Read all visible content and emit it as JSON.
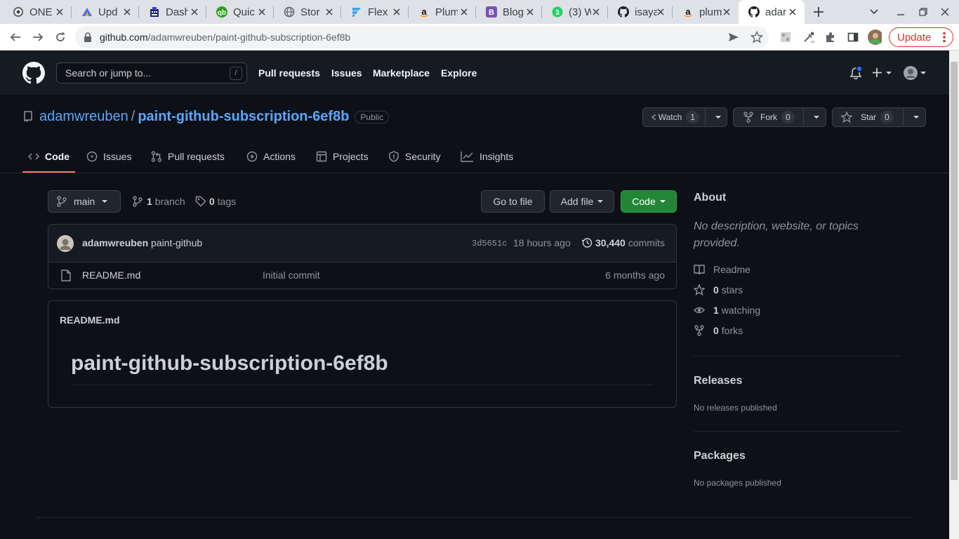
{
  "browser": {
    "tabs": [
      {
        "label": "ONE",
        "icon": "one-favicon"
      },
      {
        "label": "Upd",
        "icon": "update-favicon"
      },
      {
        "label": "Dash",
        "icon": "dashboard-favicon"
      },
      {
        "label": "Quic",
        "icon": "quickbooks-favicon"
      },
      {
        "label": "Stor",
        "icon": "globe-favicon"
      },
      {
        "label": "Flex",
        "icon": "flex-favicon"
      },
      {
        "label": "Plum",
        "icon": "amazon-favicon"
      },
      {
        "label": "Blog",
        "icon": "bootstrap-favicon"
      },
      {
        "label": "(3) W",
        "icon": "whatsapp-favicon"
      },
      {
        "label": "isaya",
        "icon": "github-favicon"
      },
      {
        "label": "plum",
        "icon": "amazon-favicon"
      },
      {
        "label": "adar",
        "icon": "github-favicon",
        "active": true
      }
    ],
    "url_host": "github.com",
    "url_path": "/adamwreuben/paint-github-subscription-6ef8b",
    "update_label": "Update",
    "accent": "#d93025"
  },
  "github": {
    "search_placeholder": "Search or jump to...",
    "search_shortcut": "/",
    "nav": [
      "Pull requests",
      "Issues",
      "Marketplace",
      "Explore"
    ],
    "notification_dot_color": "#1f6feb"
  },
  "repo": {
    "owner": "adamwreuben",
    "separator": "/",
    "name": "paint-github-subscription-6ef8b",
    "visibility": "Public",
    "watch": {
      "label": "Watch",
      "count": "1"
    },
    "fork": {
      "label": "Fork",
      "count": "0"
    },
    "star": {
      "label": "Star",
      "count": "0"
    },
    "tabs": [
      "Code",
      "Issues",
      "Pull requests",
      "Actions",
      "Projects",
      "Security",
      "Insights"
    ],
    "selected_tab_color": "#f78166"
  },
  "code": {
    "branch": "main",
    "branch_count": "1",
    "branch_word": "branch",
    "tag_count": "0",
    "tag_word": "tags",
    "go_to_file": "Go to file",
    "add_file": "Add file",
    "code_button": "Code",
    "commit": {
      "author": "adamwreuben",
      "message": "paint-github",
      "sha": "3d5651c",
      "time": "18 hours ago",
      "count": "30,440",
      "count_word": "commits"
    },
    "files": [
      {
        "name": "README.md",
        "message": "Initial commit",
        "time": "6 months ago"
      }
    ],
    "readme_title": "README.md",
    "readme_heading": "paint-github-subscription-6ef8b"
  },
  "about": {
    "title": "About",
    "description": "No description, website, or topics provided.",
    "readme": "Readme",
    "stars_count": "0",
    "stars_word": "stars",
    "watching_count": "1",
    "watching_word": "watching",
    "forks_count": "0",
    "forks_word": "forks",
    "releases_title": "Releases",
    "releases_text": "No releases published",
    "packages_title": "Packages",
    "packages_text": "No packages published"
  }
}
